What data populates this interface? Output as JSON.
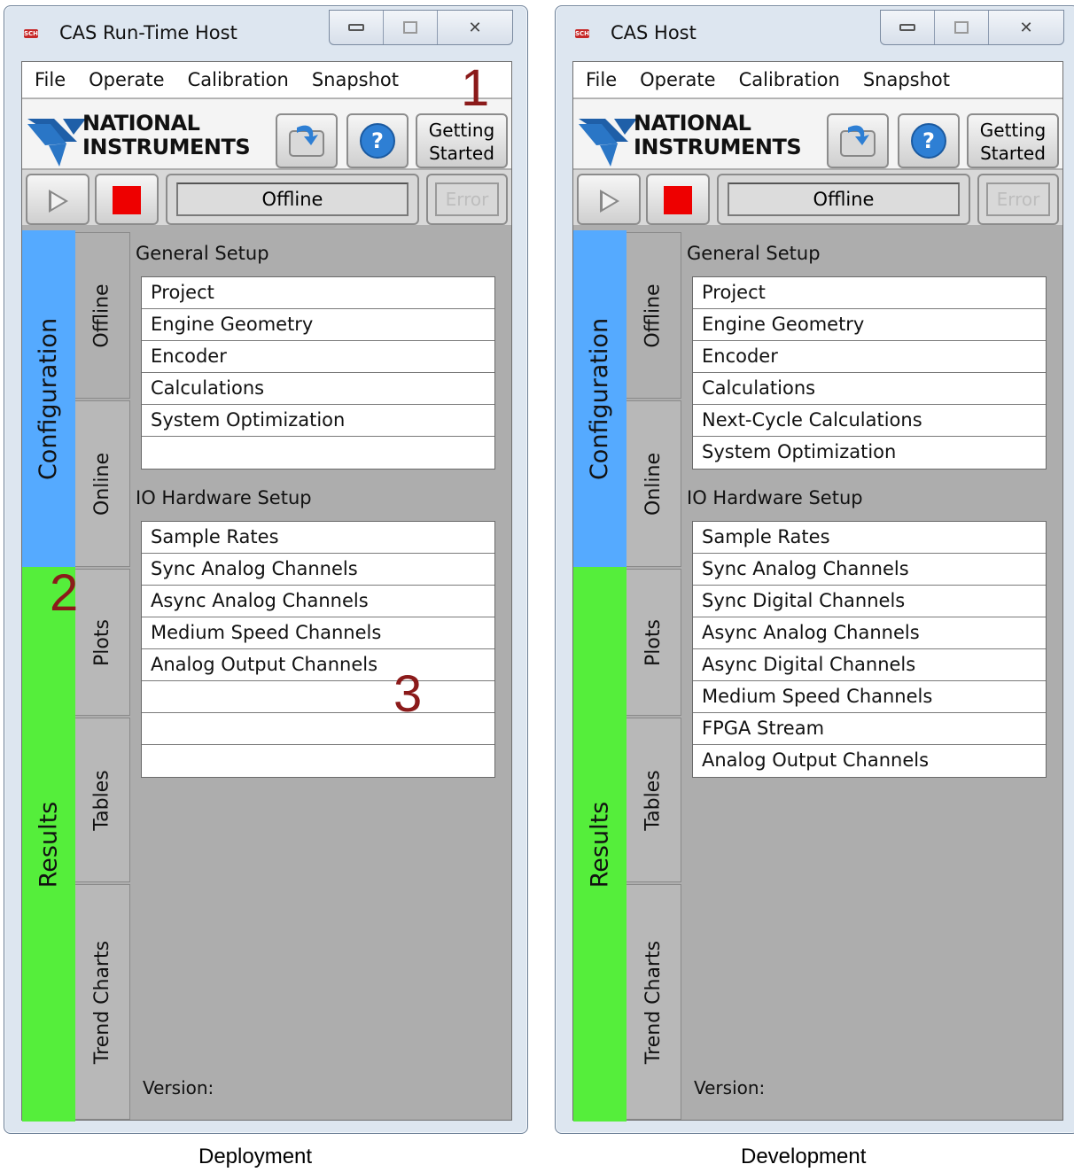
{
  "captions": {
    "left": "Deployment",
    "right": "Development"
  },
  "annotations": [
    "1",
    "2",
    "3"
  ],
  "colors": {
    "configuration_band": "#55aaff",
    "results_band": "#55ee3b",
    "stop_button": "#ee0000",
    "annotation": "#8b1a1a"
  },
  "logo": {
    "line1": "NATIONAL",
    "line2": "INSTRUMENTS"
  },
  "windows": [
    {
      "title": "CAS Run-Time Host",
      "app_icon_text": "SCH",
      "menu": [
        "File",
        "Operate",
        "Calibration",
        "Snapshot"
      ],
      "getting_started": [
        "Getting",
        "Started"
      ],
      "status": "Offline",
      "error_label": "Error",
      "bands": {
        "config": "Configuration",
        "results": "Results"
      },
      "tabs": [
        "Offline",
        "Online",
        "Plots",
        "Tables",
        "Trend Charts"
      ],
      "general_setup": {
        "label": "General Setup",
        "items": [
          "Project",
          "Engine Geometry",
          "Encoder",
          "Calculations",
          "System Optimization",
          ""
        ]
      },
      "io_setup": {
        "label": "IO Hardware Setup",
        "items": [
          "Sample Rates",
          "Sync Analog Channels",
          "Async Analog Channels",
          "Medium Speed Channels",
          "Analog Output Channels",
          "",
          "",
          ""
        ]
      },
      "version_label": "Version:"
    },
    {
      "title": "CAS Host",
      "app_icon_text": "SCH",
      "menu": [
        "File",
        "Operate",
        "Calibration",
        "Snapshot"
      ],
      "getting_started": [
        "Getting",
        "Started"
      ],
      "status": "Offline",
      "error_label": "Error",
      "bands": {
        "config": "Configuration",
        "results": "Results"
      },
      "tabs": [
        "Offline",
        "Online",
        "Plots",
        "Tables",
        "Trend Charts"
      ],
      "general_setup": {
        "label": "General Setup",
        "items": [
          "Project",
          "Engine Geometry",
          "Encoder",
          "Calculations",
          "Next-Cycle Calculations",
          "System Optimization"
        ]
      },
      "io_setup": {
        "label": "IO Hardware Setup",
        "items": [
          "Sample Rates",
          "Sync Analog Channels",
          "Sync Digital Channels",
          "Async Analog Channels",
          "Async Digital Channels",
          "Medium Speed Channels",
          "FPGA Stream",
          "Analog Output Channels"
        ]
      },
      "version_label": "Version:"
    }
  ]
}
